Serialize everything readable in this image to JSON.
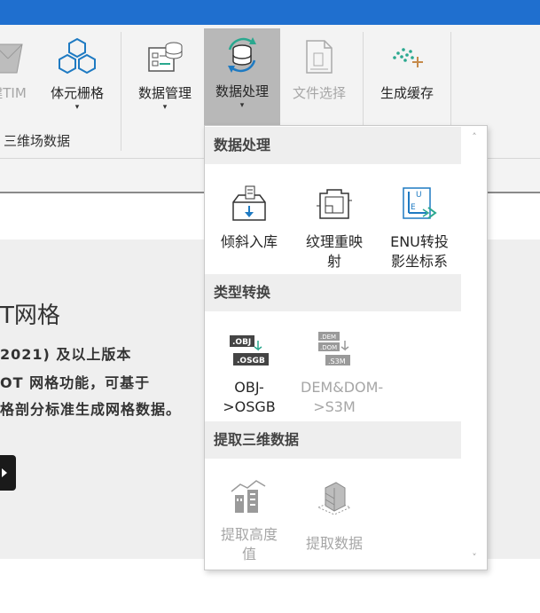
{
  "ribbon": {
    "buttons": [
      {
        "label": "建TIM",
        "has_arrow": false,
        "state": "disabled"
      },
      {
        "label": "体元栅格",
        "has_arrow": true,
        "state": "normal"
      },
      {
        "label": "数据管理",
        "has_arrow": true,
        "state": "normal"
      },
      {
        "label": "数据处理",
        "has_arrow": true,
        "state": "active"
      },
      {
        "label": "文件选择",
        "has_arrow": false,
        "state": "disabled"
      },
      {
        "label": "生成缓存",
        "has_arrow": false,
        "state": "normal"
      }
    ],
    "arrow_glyph": "▾",
    "group_label": "三维场数据"
  },
  "content": {
    "title": "T网格",
    "lines": [
      "2021) 及以上版本",
      "OT 网格功能，可基于",
      "格剖分标准生成网格数据。"
    ]
  },
  "dropdown": {
    "sections": [
      {
        "title": "数据处理",
        "items": [
          {
            "label": "倾斜入库",
            "icon": "oblique-storage-icon",
            "disabled": false
          },
          {
            "label": "纹理重映射",
            "icon": "texture-remap-icon",
            "disabled": false
          },
          {
            "label": "ENU转投影坐标系",
            "icon": "enu-projection-icon",
            "disabled": false
          }
        ]
      },
      {
        "title": "类型转换",
        "items": [
          {
            "label": "OBJ->OSGB",
            "icon": "obj-osgb-icon",
            "disabled": false
          },
          {
            "label": "DEM&DOM->S3M",
            "icon": "dem-dom-s3m-icon",
            "disabled": true
          }
        ]
      },
      {
        "title": "提取三维数据",
        "items": [
          {
            "label": "提取高度值",
            "icon": "extract-height-icon",
            "disabled": true
          },
          {
            "label": "提取数据",
            "icon": "extract-data-icon",
            "disabled": true
          }
        ]
      }
    ],
    "icon_texts": {
      "obj": ".OBJ",
      "osgb": ".OSGB",
      "dem": ".DEM",
      "dom": ".DOM",
      "s3m": ".S3M"
    },
    "scroll_up": "˄",
    "scroll_down": "˅"
  },
  "colors": {
    "titlebar": "#1f6fcf",
    "active_button": "#b8b8b8",
    "accent_teal": "#2aa88f"
  }
}
